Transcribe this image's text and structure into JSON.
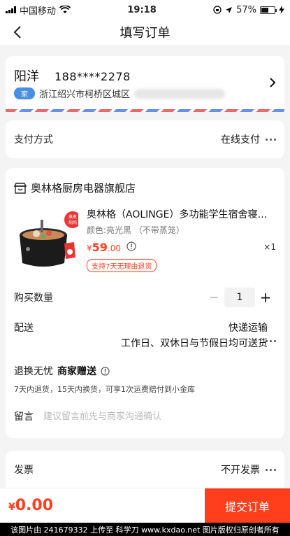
{
  "status": {
    "carrier": "中国移动",
    "time": "19:18",
    "battery": "57%",
    "battery_level": 0.57
  },
  "nav": {
    "title": "填写订单"
  },
  "address": {
    "name": "阳洋",
    "phone": "188****2278",
    "tag": "家",
    "line": "浙江绍兴市柯桥区城区"
  },
  "payment": {
    "label": "支付方式",
    "value": "在线支付"
  },
  "shop": {
    "name": "奥林格厨房电器旗舰店",
    "product": {
      "title": "奥林格（AOLINGE）多功能学生宿舍寝…",
      "spec": "颜色:亮光黑 （不带蒸笼）",
      "price_symbol": "¥",
      "price_int": "59",
      "price_dec": ".00",
      "qty_text": "×1",
      "badge": "支持7天无理由退货",
      "img_tag": "蒸煮焖炖"
    },
    "quantity": {
      "label": "购买数量",
      "minus": "−",
      "value": "1",
      "plus": "+"
    },
    "delivery": {
      "label": "配送",
      "method": "快递运输",
      "note": "工作日、双休日与节假日均可送货"
    },
    "service": {
      "title": "退换无忧",
      "gift": "商家赠送",
      "desc": "7天内退货，15天内换货，可享1次运费赔付到小金库"
    },
    "note": {
      "label": "留言",
      "placeholder": "建议留言前先与商家沟通确认",
      "value": ""
    }
  },
  "invoice": {
    "label": "发票",
    "value": "不开发票"
  },
  "bottom": {
    "total_symbol": "¥",
    "total": "0.00",
    "submit": "提交订单"
  },
  "watermark": "该图片由 241679332 上传至 科学刀 www.kxdao.net 图片版权归原创者所有",
  "colors": {
    "accent": "#ff3e1c",
    "address_tag": "#4a90e2"
  }
}
